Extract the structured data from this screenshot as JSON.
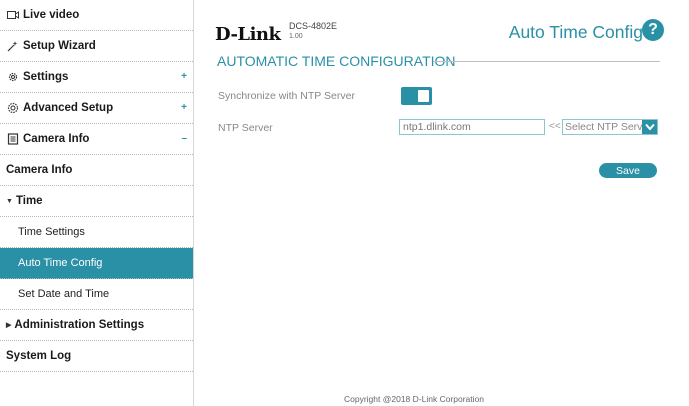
{
  "sidebar": {
    "items": [
      {
        "label": "Live video",
        "icon": "video-icon",
        "toggle": ""
      },
      {
        "label": "Setup Wizard",
        "icon": "wizard-icon",
        "toggle": ""
      },
      {
        "label": "Settings",
        "icon": "gear-icon",
        "toggle": "+"
      },
      {
        "label": "Advanced Setup",
        "icon": "advanced-gear-icon",
        "toggle": "+"
      },
      {
        "label": "Camera Info",
        "icon": "document-icon",
        "toggle": "–"
      },
      {
        "label": "Camera Info"
      },
      {
        "label": "Time"
      },
      {
        "label": "Time Settings"
      },
      {
        "label": "Auto Time Config"
      },
      {
        "label": "Set Date and Time"
      },
      {
        "label": "Administration Settings"
      },
      {
        "label": "System Log"
      }
    ]
  },
  "header": {
    "brand": "D-Link",
    "model": "DCS-4802E",
    "firmware": "1.00",
    "page_title": "Auto Time Config",
    "help_symbol": "?"
  },
  "main": {
    "section_title": "AUTOMATIC TIME CONFIGURATION",
    "sync_label": "Synchronize with NTP Server",
    "sync_enabled": true,
    "ntp_label": "NTP Server",
    "ntp_value": "ntp1.dlink.com",
    "arrows": "<<",
    "select_value": "Select NTP Server",
    "save_label": "Save"
  },
  "footer": {
    "copyright": "Copyright @2018 D-Link Corporation"
  },
  "colors": {
    "accent": "#2a90a6",
    "border": "#8dc6d3"
  }
}
